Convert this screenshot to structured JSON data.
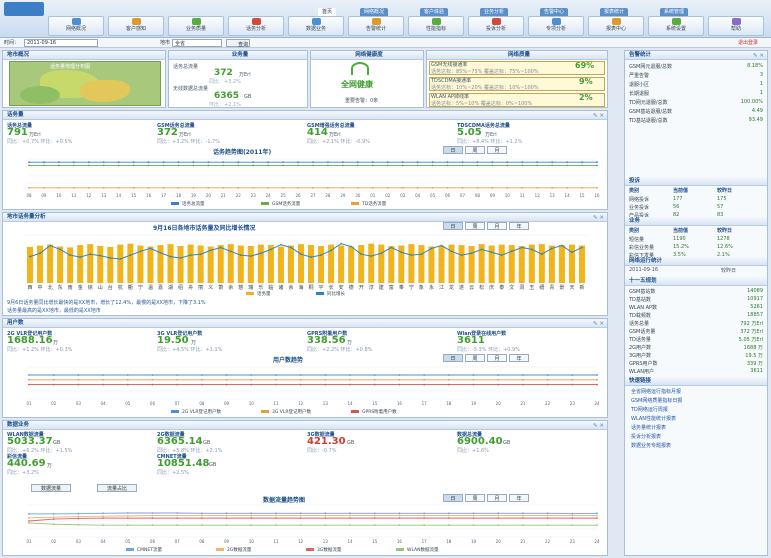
{
  "header": {
    "logo": "",
    "tabs": [
      "首页",
      "网络概况",
      "客户体验",
      "业务分析",
      "告警中心",
      "报表统计",
      "系统管理"
    ],
    "nav_buttons": [
      "网络概况",
      "客户感知",
      "业务质量",
      "话务分析",
      "数据业务",
      "告警统计",
      "性能指标",
      "投诉分析",
      "专项分析",
      "报表中心",
      "系统设置",
      "帮助"
    ],
    "user_link": "退出登录"
  },
  "query": {
    "date_label": "时间：",
    "date": "2011-09-16",
    "region_label": "地市",
    "region": "全省",
    "button": "查询"
  },
  "map": {
    "title": "地市概况",
    "caption": "话务量地理分布图"
  },
  "biz": {
    "title": "业务量",
    "cells": [
      {
        "label": "话务总流量",
        "value": "372",
        "unit": "万Erl",
        "sub1": "同比：+3.2%",
        "sub2": "环比：-1.7%"
      },
      {
        "label": "无线数据总流量",
        "value": "6365",
        "unit": "GB",
        "sub1": "同比：+5.8%",
        "sub2": "环比：+2.1%"
      }
    ]
  },
  "health": {
    "title": "网络健康度",
    "status": "全网健康",
    "note": "重要告警：0条"
  },
  "quality": {
    "title": "网络质量",
    "rows": [
      {
        "label": "GSM无线接通率",
        "value": "69%",
        "sub": "话务达标：85%~75% 覆盖达标：75%~100%"
      },
      {
        "label": "TDSCDMA接通率",
        "value": "9%",
        "sub": "话务达标：10%~20% 覆盖达标：10%~100%"
      },
      {
        "label": "WLAN AP掉线率",
        "value": "2%",
        "sub": "话务达标：5%~10% 覆盖达标：0%~100%"
      }
    ]
  },
  "voice": {
    "title": "话务量",
    "cards": [
      {
        "label": "话务总流量",
        "value": "791",
        "unit": "万Erl",
        "sub": "同比：+0.7% 环比：+0.5%"
      },
      {
        "label": "GSM话务总流量",
        "value": "372",
        "unit": "万Erl",
        "sub": "同比：+3.2% 环比：-1.7%"
      },
      {
        "label": "GSM增强话务总流量",
        "value": "414",
        "unit": "万Erl",
        "sub": "同比：+2.1% 环比：-0.9%"
      },
      {
        "label": "TDSCDMA话务总流量",
        "value": "5.05",
        "unit": "万Erl",
        "sub": "同比：+8.4% 环比：+1.2%"
      }
    ],
    "chart_title": "话务趋势图(2011年)",
    "chart_tabs": [
      "日",
      "周",
      "月"
    ]
  },
  "city": {
    "title": "地市话务量分析",
    "chart_title": "9月16日各地市话务量及同比增长情况",
    "chart_tabs": [
      "日",
      "周",
      "月",
      "年"
    ],
    "note1": "9月6日话务量同比增长最快的是XX地市，增长了12.4%，最慢的是XX地市，下降了3.1%",
    "note2": "话务量最高的是XX地市，最低的是XX地市"
  },
  "users": {
    "title": "用户数",
    "cards": [
      {
        "label": "2G VLR登记用户数",
        "value": "1688.16",
        "unit": "万",
        "sub": "同比：+1.2% 环比：+0.3%"
      },
      {
        "label": "3G VLR登记用户数",
        "value": "19.50",
        "unit": "万",
        "sub": "同比：+4.5% 环比：+1.1%"
      },
      {
        "label": "GPRS附着用户数",
        "value": "338.56",
        "unit": "万",
        "sub": "同比：+2.2% 环比：+0.8%"
      },
      {
        "label": "Wlan登录在线用户数",
        "value": "3611",
        "unit": "",
        "sub": "同比：-5.3% 环比：+0.9%"
      }
    ],
    "chart_title": "用户数趋势",
    "chart_tabs": [
      "日",
      "周",
      "月",
      "年"
    ]
  },
  "data": {
    "title": "数据业务",
    "cards": [
      {
        "label": "WLAN数据流量",
        "value": "5033.37",
        "unit": "GB",
        "sub": "同比：+6.2% 环比：+1.5%"
      },
      {
        "label": "2G数据流量",
        "value": "6365.14",
        "unit": "GB",
        "sub": "同比：+5.8% 环比：+2.1%"
      },
      {
        "label": "3G数据流量",
        "value": "421.30",
        "unit": "GB",
        "sub": "同比：-0.7%"
      },
      {
        "label": "数据总流量",
        "value": "6900.40",
        "unit": "GB",
        "sub": "同比：+1.6%"
      },
      {
        "label": "彩信流量",
        "value": "440.69",
        "unit": "万",
        "sub": "同比：+3.2%"
      },
      {
        "label": "CMNET流量",
        "value": "10851.48",
        "unit": "GB",
        "sub": "同比：+2.5%"
      }
    ],
    "sub_tabs": [
      "数据流量",
      "流量占比"
    ],
    "chart_title": "数据流量趋势图",
    "chart_tabs": [
      "日",
      "周",
      "月",
      "年"
    ]
  },
  "side": {
    "alarm": {
      "title": "告警统计",
      "rows": [
        {
          "k": "GSM网元退服/总数",
          "v": "8.18%"
        },
        {
          "k": "严重告警",
          "v": "3"
        },
        {
          "k": "退服小区",
          "v": "1"
        },
        {
          "k": "长期退服",
          "v": "1"
        },
        {
          "k": "TD网元退服/总数",
          "v": "100.00%"
        },
        {
          "k": "GSM基站退服/总数",
          "v": "4.49"
        },
        {
          "k": "TD基站退服/总数",
          "v": "93.49"
        }
      ]
    },
    "complaint": {
      "title": "投诉",
      "head": [
        "类别",
        "当前值",
        "较昨日"
      ],
      "rows": [
        [
          "网络投诉",
          "177",
          "175"
        ],
        [
          "业务投诉",
          "56",
          "57"
        ],
        [
          "产品投诉",
          "82",
          "83"
        ]
      ]
    },
    "bizs": {
      "title": "业务",
      "head": [
        "类别",
        "当前值",
        "较昨日"
      ],
      "rows": [
        [
          "短信量",
          "1190",
          "1278"
        ],
        [
          "彩信业务量",
          "15.2%",
          "12.6%"
        ],
        [
          "彩信下发量",
          "3.5%",
          "2.1%"
        ]
      ]
    },
    "ops": {
      "title": "网络运行统计",
      "date": "2011-09-16",
      "label": "较昨日"
    },
    "res": {
      "title": "十一五规划",
      "rows": [
        {
          "k": "GSM基站数",
          "v": "14089"
        },
        {
          "k": "TD基站数",
          "v": "10917"
        },
        {
          "k": "WLAN AP数",
          "v": "5261"
        },
        {
          "k": "TD载频数",
          "v": "18857"
        },
        {
          "k": "话务总量",
          "v": "792 万Erl"
        },
        {
          "k": "GSM话务量",
          "v": "372 万Erl"
        },
        {
          "k": "TD话务量",
          "v": "5.05 万Erl"
        },
        {
          "k": "2G用户数",
          "v": "1688 万"
        },
        {
          "k": "3G用户数",
          "v": "19.5 万"
        },
        {
          "k": "GPRS用户数",
          "v": "339 万"
        },
        {
          "k": "WLAN用户",
          "v": "3611"
        }
      ]
    },
    "links": {
      "title": "快速链接",
      "items": [
        "全省网络运行指标月报",
        "GSM网络质量指标日报",
        "TD网络运行周报",
        "WLAN性能统计报表",
        "话务量统计报表",
        "投诉分析报表",
        "数据业务专题报表"
      ]
    }
  },
  "chart_data": [
    {
      "type": "line",
      "title": "话务趋势图(2011年)",
      "x": [
        "08",
        "09",
        "10",
        "11",
        "12",
        "13",
        "14",
        "15",
        "16",
        "17",
        "18",
        "19",
        "20",
        "21",
        "22",
        "23",
        "24",
        "25",
        "26",
        "27",
        "28",
        "29",
        "30",
        "01",
        "02",
        "03",
        "04",
        "05",
        "06",
        "07",
        "08",
        "09",
        "10",
        "11",
        "12",
        "13",
        "14",
        "15",
        "16"
      ],
      "series": [
        {
          "name": "话务总流量",
          "values": [
            18,
            18,
            18,
            18,
            18,
            18,
            18,
            18,
            18,
            18,
            18,
            18,
            18,
            18,
            18,
            18,
            18,
            18,
            18,
            18,
            18,
            18,
            18,
            18,
            18,
            18,
            18,
            18,
            18,
            18,
            18,
            18,
            18,
            18,
            18,
            18,
            18,
            18,
            18
          ]
        },
        {
          "name": "GSM话务流量",
          "values": [
            16,
            16,
            16,
            16,
            16,
            16,
            16,
            16,
            16,
            16,
            16,
            16,
            16,
            16,
            16,
            16,
            16,
            16,
            16,
            16,
            16,
            16,
            16,
            16,
            16,
            16,
            16,
            16,
            16,
            16,
            16,
            16,
            16,
            16,
            16,
            16,
            16,
            16,
            16
          ]
        },
        {
          "name": "TD话务流量",
          "values": [
            2,
            2,
            2,
            2,
            2,
            2,
            2,
            2,
            2,
            2,
            2,
            2,
            2,
            2,
            2,
            2,
            2,
            2,
            2,
            2,
            2,
            2,
            2,
            2,
            2,
            2,
            2,
            2,
            2,
            2,
            2,
            2,
            2,
            2,
            2,
            2,
            2,
            2,
            2
          ]
        }
      ],
      "ylim": [
        0,
        20
      ]
    },
    {
      "type": "bar",
      "title": "9月16日各地市话务量及同比增长情况",
      "categories": [
        "西",
        "中",
        "北",
        "东",
        "南",
        "金",
        "徐",
        "山",
        "台",
        "杭",
        "衢",
        "宁",
        "温",
        "嘉",
        "湖",
        "绍",
        "舟",
        "丽",
        "义",
        "萧",
        "余",
        "慈",
        "瑞",
        "乐",
        "临",
        "诸",
        "余",
        "海",
        "桐",
        "平",
        "长",
        "安",
        "德",
        "开",
        "淳",
        "建",
        "富",
        "奉",
        "宁",
        "象",
        "永",
        "江",
        "龙",
        "遂",
        "云",
        "松",
        "庆",
        "泰",
        "文",
        "洞",
        "玉",
        "缙",
        "青",
        "景",
        "天",
        "新"
      ],
      "series": [
        {
          "name": "话务量",
          "values": [
            75,
            78,
            80,
            76,
            74,
            79,
            81,
            77,
            75,
            80,
            82,
            78,
            76,
            79,
            81,
            77,
            80,
            78,
            76,
            79,
            81,
            78,
            77,
            80,
            79,
            76,
            78,
            81,
            79,
            77,
            80,
            78,
            76,
            79,
            82,
            80,
            77,
            78,
            81,
            79,
            76,
            78,
            80,
            79,
            77,
            81,
            78,
            80,
            79,
            77,
            80,
            81,
            78,
            79,
            80,
            78
          ]
        },
        {
          "name": "同比增长",
          "values": [
            55,
            62,
            78,
            70,
            58,
            54,
            60,
            57,
            52,
            50,
            58,
            66,
            72,
            63,
            55,
            52,
            58,
            60,
            68,
            74,
            66,
            58,
            56,
            62,
            70,
            80,
            74,
            60,
            54,
            58,
            68,
            82,
            76,
            60,
            56,
            62,
            74,
            64,
            58,
            60,
            72,
            78,
            66,
            58,
            62,
            70,
            64,
            58,
            66,
            74,
            70,
            60,
            72,
            78,
            64,
            74
          ]
        }
      ],
      "ylim": [
        0,
        100
      ]
    },
    {
      "type": "line",
      "title": "用户数趋势",
      "x": [
        "01",
        "02",
        "03",
        "04",
        "05",
        "06",
        "07",
        "08",
        "09",
        "10",
        "11",
        "12",
        "13",
        "14",
        "15",
        "16",
        "17",
        "18",
        "19",
        "20",
        "21",
        "22",
        "23",
        "24"
      ],
      "series": [
        {
          "name": "2G VLR登记用户数",
          "values": [
            60,
            60,
            60,
            60,
            60,
            60,
            60,
            60,
            60,
            60,
            60,
            60,
            60,
            60,
            60,
            60,
            60,
            60,
            60,
            60,
            60,
            60,
            60,
            60
          ]
        },
        {
          "name": "3G VLR登记用户数",
          "values": [
            48,
            48,
            48,
            48,
            48,
            48,
            48,
            48,
            48,
            48,
            48,
            48,
            48,
            48,
            48,
            48,
            48,
            48,
            48,
            48,
            48,
            48,
            48,
            48
          ]
        },
        {
          "name": "GPRS附着用户数",
          "values": [
            36,
            36,
            36,
            36,
            36,
            36,
            36,
            36,
            36,
            36,
            36,
            36,
            36,
            36,
            36,
            36,
            36,
            36,
            36,
            36,
            36,
            36,
            36,
            36
          ]
        }
      ],
      "ylim": [
        0,
        80
      ]
    },
    {
      "type": "line",
      "title": "数据流量趋势图",
      "x": [
        "01",
        "02",
        "03",
        "04",
        "05",
        "06",
        "07",
        "08",
        "09",
        "10",
        "11",
        "12",
        "13",
        "14",
        "15",
        "16",
        "17",
        "18",
        "19",
        "20",
        "21",
        "22",
        "23",
        "24"
      ],
      "series": [
        {
          "name": "CMNET流量",
          "values": [
            72,
            72,
            73,
            74,
            75,
            75,
            75,
            74,
            74,
            74,
            74,
            74,
            74,
            74,
            74,
            74,
            74,
            74,
            74,
            74,
            74,
            74,
            73,
            74
          ]
        },
        {
          "name": "2G数据流量",
          "values": [
            60,
            62,
            64,
            65,
            66,
            67,
            67,
            67,
            67,
            67,
            67,
            67,
            67,
            67,
            67,
            67,
            67,
            67,
            67,
            67,
            67,
            67,
            67,
            67
          ]
        },
        {
          "name": "3G数据流量",
          "values": [
            50,
            56,
            58,
            59,
            59,
            59,
            59,
            59,
            59,
            59,
            59,
            59,
            59,
            59,
            59,
            59,
            59,
            59,
            59,
            59,
            59,
            59,
            59,
            59
          ]
        },
        {
          "name": "WLAN数据流量",
          "values": [
            44,
            40,
            38,
            37,
            37,
            37,
            37,
            37,
            37,
            37,
            37,
            37,
            37,
            37,
            37,
            37,
            37,
            37,
            37,
            37,
            37,
            37,
            37,
            37
          ]
        }
      ],
      "ylim": [
        0,
        100
      ]
    }
  ]
}
